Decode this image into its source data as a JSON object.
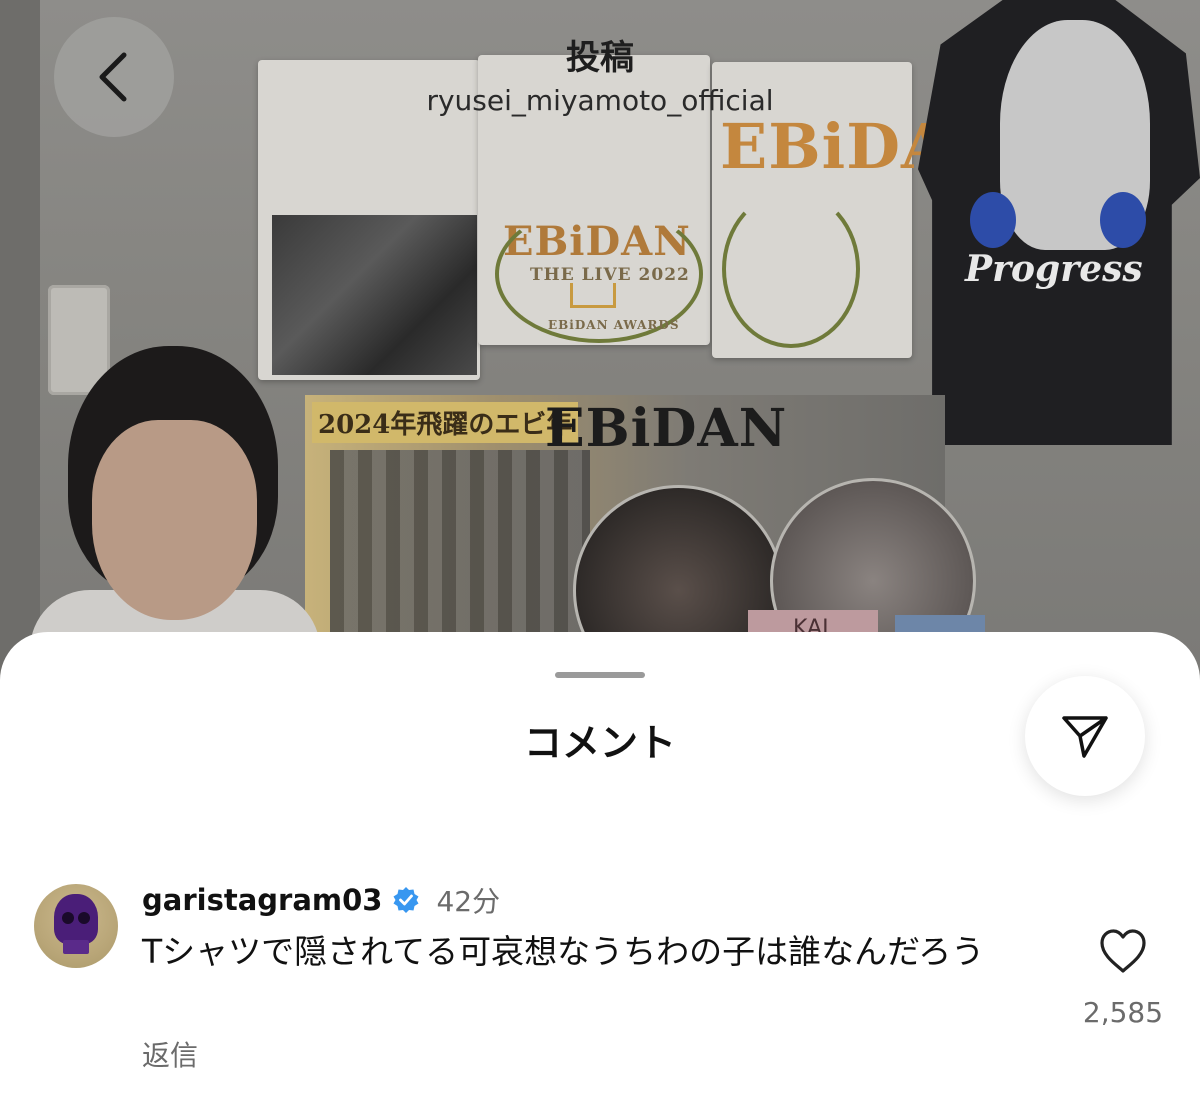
{
  "header": {
    "title": "投稿",
    "account": "ryusei_miyamoto_official"
  },
  "photo": {
    "poster_title": "2024年飛躍のエビ年",
    "poster_logo": "EBiDAN",
    "shirt_logo": "EBiDAN",
    "shirt_subtitle": "THE LIVE 2022",
    "shirt_footer": "EBiDAN AWARDS",
    "black_shirt_text": "Progress",
    "tag_text": "KAI"
  },
  "sheet": {
    "title": "コメント"
  },
  "comment": {
    "username": "garistagram03",
    "time": "42分",
    "text": "Tシャツで隠されてる可哀想なうちわの子は誰なんだろう",
    "reply_label": "返信",
    "like_count": "2,585",
    "verified": true
  },
  "colors": {
    "verified": "#3897f0",
    "sheet": "#ffffff"
  },
  "icons": {
    "back": "chevron-left-icon",
    "share": "send-icon",
    "like": "heart-icon",
    "verified": "verified-badge-icon"
  }
}
